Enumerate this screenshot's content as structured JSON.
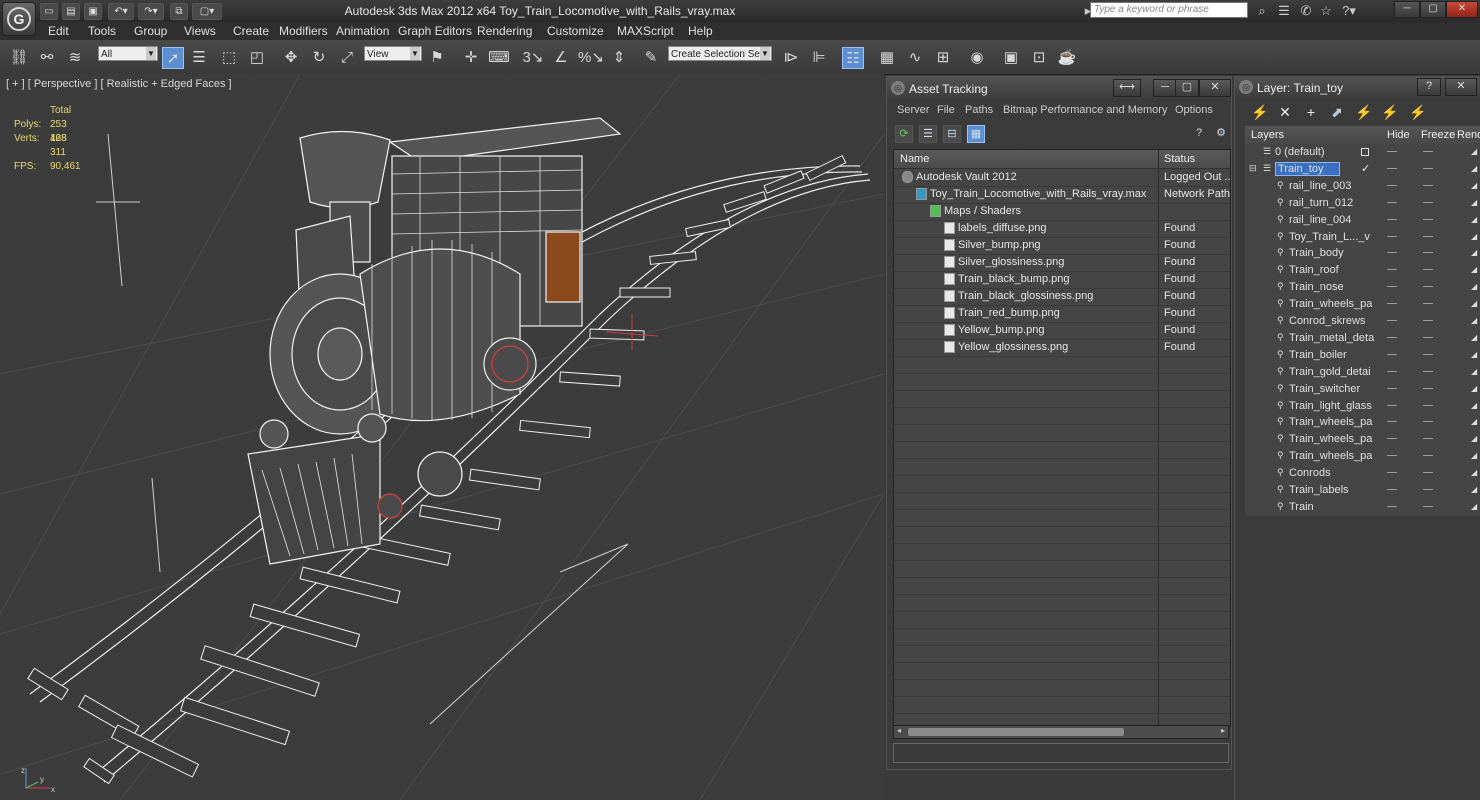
{
  "app": {
    "title": "Autodesk 3ds Max  2012 x64     Toy_Train_Locomotive_with_Rails_vray.max",
    "search_placeholder": "Type a keyword or phrase"
  },
  "menu": [
    "Edit",
    "Tools",
    "Group",
    "Views",
    "Create",
    "Modifiers",
    "Animation",
    "Graph Editors",
    "Rendering",
    "Customize",
    "MAXScript",
    "Help"
  ],
  "toolbar": {
    "filter_value": "All",
    "refcoord_value": "View",
    "selection_set_value": "Create Selection Se",
    "snap_label": "3",
    "percent_label": "%"
  },
  "viewport": {
    "label": "[ + ] [ Perspective ] [ Realistic + Edged Faces ]",
    "stats_header": "Total",
    "polys_label": "Polys:",
    "polys_value": "253 468",
    "verts_label": "Verts:",
    "verts_value": "128 311",
    "fps_label": "FPS:",
    "fps_value": "90,461",
    "axis_x": "x",
    "axis_y": "y",
    "axis_z": "z"
  },
  "asset_tracking": {
    "title": "Asset Tracking",
    "menu": [
      "Server",
      "File",
      "Paths",
      "Bitmap Performance and Memory",
      "Options"
    ],
    "col_name": "Name",
    "col_status": "Status",
    "rows": [
      {
        "name": "Autodesk Vault 2012",
        "status": "Logged Out ...",
        "indent": 0
      },
      {
        "name": "Toy_Train_Locomotive_with_Rails_vray.max",
        "status": "Network Path",
        "indent": 1
      },
      {
        "name": "Maps / Shaders",
        "status": "",
        "indent": 2
      },
      {
        "name": "labels_diffuse.png",
        "status": "Found",
        "indent": 3
      },
      {
        "name": "Silver_bump.png",
        "status": "Found",
        "indent": 3
      },
      {
        "name": "Silver_glossiness.png",
        "status": "Found",
        "indent": 3
      },
      {
        "name": "Train_black_bump.png",
        "status": "Found",
        "indent": 3
      },
      {
        "name": "Train_black_glossiness.png",
        "status": "Found",
        "indent": 3
      },
      {
        "name": "Train_red_bump.png",
        "status": "Found",
        "indent": 3
      },
      {
        "name": "Yellow_bump.png",
        "status": "Found",
        "indent": 3
      },
      {
        "name": "Yellow_glossiness.png",
        "status": "Found",
        "indent": 3
      }
    ]
  },
  "layer_panel": {
    "title": "Layer: Train_toy",
    "col_layers": "Layers",
    "col_hide": "Hide",
    "col_freeze": "Freeze",
    "col_render": "Rende",
    "rows": [
      {
        "name": "0 (default)",
        "level": 0
      },
      {
        "name": "Train_toy",
        "level": 0,
        "selected": true
      },
      {
        "name": "rail_line_003",
        "level": 1
      },
      {
        "name": "rail_turn_012",
        "level": 1
      },
      {
        "name": "rail_line_004",
        "level": 1
      },
      {
        "name": "Toy_Train_L..._v",
        "level": 1
      },
      {
        "name": "Train_body",
        "level": 1
      },
      {
        "name": "Train_roof",
        "level": 1
      },
      {
        "name": "Train_nose",
        "level": 1
      },
      {
        "name": "Train_wheels_pa",
        "level": 1
      },
      {
        "name": "Conrod_skrews",
        "level": 1
      },
      {
        "name": "Train_metal_deta",
        "level": 1
      },
      {
        "name": "Train_boiler",
        "level": 1
      },
      {
        "name": "Train_gold_detai",
        "level": 1
      },
      {
        "name": "Train_switcher",
        "level": 1
      },
      {
        "name": "Train_light_glass",
        "level": 1
      },
      {
        "name": "Train_wheels_pa",
        "level": 1
      },
      {
        "name": "Train_wheels_pa",
        "level": 1
      },
      {
        "name": "Train_wheels_pa",
        "level": 1
      },
      {
        "name": "Conrods",
        "level": 1
      },
      {
        "name": "Train_labels",
        "level": 1
      },
      {
        "name": "Train",
        "level": 1
      }
    ]
  }
}
